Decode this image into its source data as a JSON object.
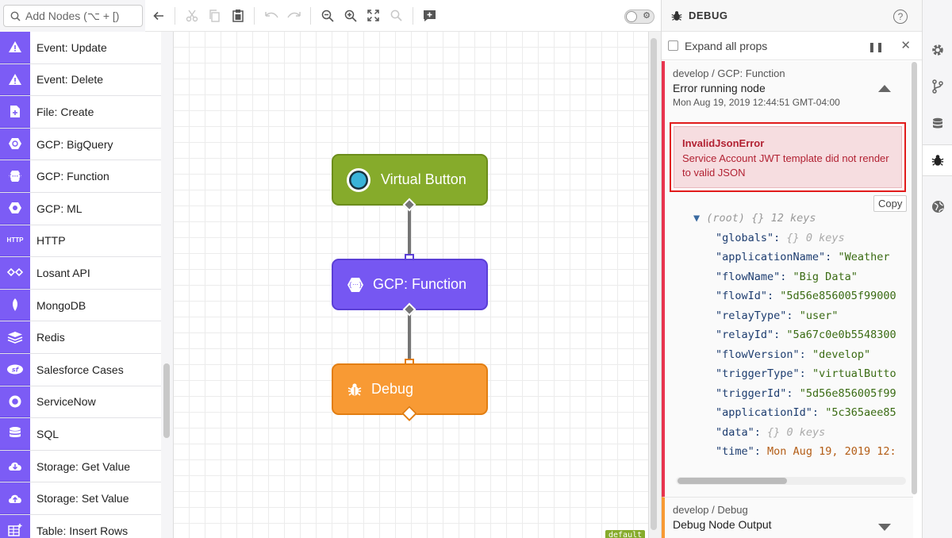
{
  "palette": {
    "search_placeholder": "Add Nodes (⌥ + [)",
    "items": [
      {
        "label": "Event: Update",
        "icon": "alert-icon"
      },
      {
        "label": "Event: Delete",
        "icon": "alert-icon"
      },
      {
        "label": "File: Create",
        "icon": "file-plus-icon"
      },
      {
        "label": "GCP: BigQuery",
        "icon": "gcp-icon"
      },
      {
        "label": "GCP: Function",
        "icon": "gcp-function-icon"
      },
      {
        "label": "GCP: ML",
        "icon": "gcp-icon"
      },
      {
        "label": "HTTP",
        "icon": "http-icon",
        "icon_text": "HTTP"
      },
      {
        "label": "Losant API",
        "icon": "losant-icon"
      },
      {
        "label": "MongoDB",
        "icon": "leaf-icon"
      },
      {
        "label": "Redis",
        "icon": "layers-icon"
      },
      {
        "label": "Salesforce Cases",
        "icon": "salesforce-icon",
        "icon_text": "sf"
      },
      {
        "label": "ServiceNow",
        "icon": "servicenow-icon"
      },
      {
        "label": "SQL",
        "icon": "database-icon"
      },
      {
        "label": "Storage: Get Value",
        "icon": "cloud-download-icon"
      },
      {
        "label": "Storage: Set Value",
        "icon": "cloud-upload-icon"
      },
      {
        "label": "Table: Insert Rows",
        "icon": "table-plus-icon"
      }
    ]
  },
  "canvas": {
    "nodes": [
      {
        "label": "Virtual Button",
        "color": "#86ab2b"
      },
      {
        "label": "GCP: Function",
        "color": "#7657f2"
      },
      {
        "label": "Debug",
        "color": "#f89a34"
      }
    ],
    "version_tag": "default"
  },
  "debug": {
    "title": "DEBUG",
    "expand_all_label": "Expand all props",
    "messages": [
      {
        "crumb": "develop / GCP: Function",
        "title": "Error running node",
        "time": "Mon Aug 19, 2019 12:44:51 GMT-04:00",
        "status_color": "#e8344e",
        "error_name": "InvalidJsonError",
        "error_message": "Service Account JWT template did not render to valid JSON",
        "copy_label": "Copy",
        "root_label": "(root)",
        "root_braces": "{}",
        "root_count": "12 keys",
        "props": [
          {
            "key": "\"globals\":",
            "braces": "{}",
            "meta": "0 keys"
          },
          {
            "key": "\"applicationName\":",
            "value": "\"Weather"
          },
          {
            "key": "\"flowName\":",
            "value": "\"Big Data\""
          },
          {
            "key": "\"flowId\":",
            "value": "\"5d56e856005f99000"
          },
          {
            "key": "\"relayType\":",
            "value": "\"user\""
          },
          {
            "key": "\"relayId\":",
            "value": "\"5a67c0e0b5548300"
          },
          {
            "key": "\"flowVersion\":",
            "value": "\"develop\""
          },
          {
            "key": "\"triggerType\":",
            "value": "\"virtualButto"
          },
          {
            "key": "\"triggerId\":",
            "value": "\"5d56e856005f99"
          },
          {
            "key": "\"applicationId\":",
            "value": "\"5c365aee85"
          },
          {
            "key": "\"data\":",
            "braces": "{}",
            "meta": "0 keys"
          },
          {
            "key": "\"time\":",
            "date": "Mon Aug 19, 2019 12:"
          }
        ]
      },
      {
        "crumb": "develop / Debug",
        "title": "Debug Node Output",
        "status_color": "#f89a34"
      }
    ]
  }
}
